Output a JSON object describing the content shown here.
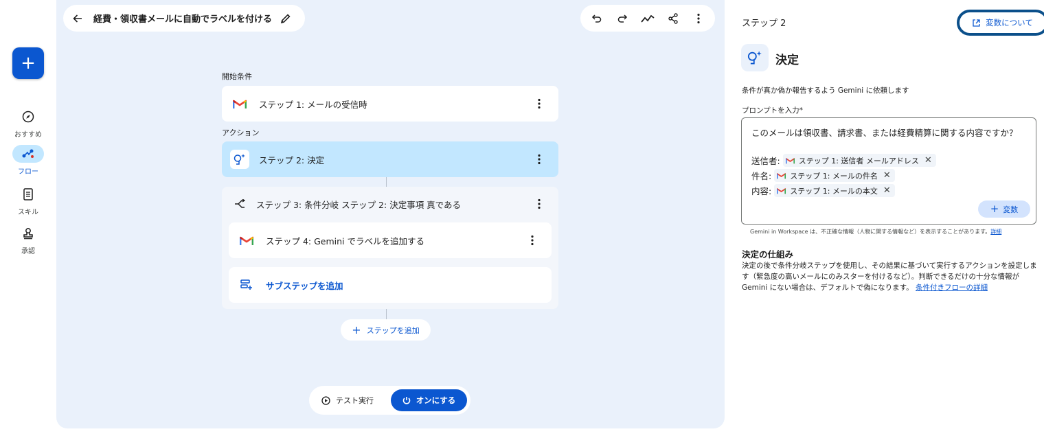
{
  "rail": {
    "fab_label": "+",
    "items": [
      {
        "label": "おすすめ",
        "icon": "compass-icon"
      },
      {
        "label": "フロー",
        "icon": "flow-icon",
        "active": true
      },
      {
        "label": "スキル",
        "icon": "skill-icon"
      },
      {
        "label": "承認",
        "icon": "approval-stamp-icon"
      }
    ]
  },
  "header": {
    "title": "経費・領収書メールに自動でラベルを付ける",
    "back_icon": "arrow-back-icon",
    "edit_icon": "pencil-icon",
    "toolbar": [
      "undo-icon",
      "redo-icon",
      "activity-icon",
      "share-icon",
      "more-vert-icon"
    ]
  },
  "flow": {
    "start_label": "開始条件",
    "action_label": "アクション",
    "steps": [
      {
        "text": "ステップ 1: メールの受信時",
        "icon": "gmail-icon"
      },
      {
        "text": "ステップ 2: 決定",
        "icon": "gemini-decide-icon",
        "selected": true
      },
      {
        "text": "ステップ 3: 条件分岐 ステップ 2: 決定事項 真である",
        "icon": "branch-icon"
      },
      {
        "text": "ステップ 4: Gemini でラベルを追加する",
        "icon": "gmail-icon"
      }
    ],
    "add_substep": "サブステップを追加",
    "add_step": "ステップを追加"
  },
  "run_bar": {
    "test_label": "テスト実行",
    "on_label": "オンにする"
  },
  "panel": {
    "step_no": "ステップ 2",
    "vars_button": "変数について",
    "title": "決定",
    "description": "条件が真か偽か報告するよう Gemini に依頼します",
    "prompt_label": "プロンプトを入力*",
    "prompt_text": "このメールは領収書、請求書、または経費精算に関する内容ですか？",
    "variables": [
      {
        "label": "送信者:",
        "chip": "ステップ 1: 送信者 メールアドレス"
      },
      {
        "label": "件名:",
        "chip": "ステップ 1: メールの件名"
      },
      {
        "label": "内容:",
        "chip": "ステップ 1: メールの本文"
      }
    ],
    "add_variable": "変数",
    "disclaimer": "Gemini in Workspace は、不正確な情報（人物に関する情報など）を表示することがあります。",
    "disclaimer_link": "詳細",
    "how_title": "決定の仕組み",
    "how_text": "決定の後で条件分岐ステップを使用し、その結果に基づいて実行するアクションを設定します（緊急度の高いメールにのみスターを付けるなど）。判断できるだけの十分な情報が Gemini にない場合は、デフォルトで偽になります。",
    "how_link": "条件付きフローの詳細"
  }
}
